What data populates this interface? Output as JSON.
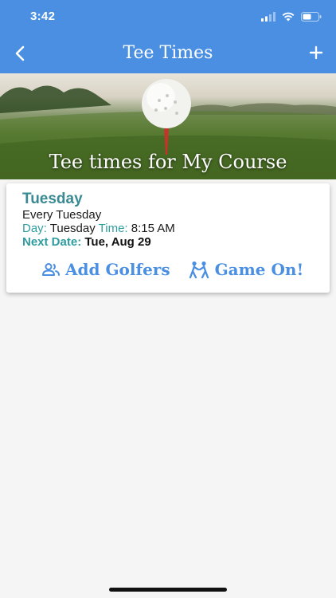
{
  "status_bar": {
    "time": "3:42"
  },
  "nav": {
    "title": "Tee Times"
  },
  "hero": {
    "caption": "Tee times for My Course"
  },
  "tee_times": [
    {
      "name": "Tuesday",
      "recurrence": "Every Tuesday",
      "day_label": "Day:",
      "day_value": "Tuesday",
      "time_label": "Time:",
      "time_value": "8:15 AM",
      "next_date_label": "Next Date:",
      "next_date_value": "Tue, Aug 29",
      "actions": {
        "add_golfers": "Add Golfers",
        "game_on": "Game On!"
      }
    }
  ],
  "colors": {
    "nav_bar": "#4a8fe2",
    "accent_teal": "#3a8a93",
    "action_blue": "#4a8fe2"
  }
}
